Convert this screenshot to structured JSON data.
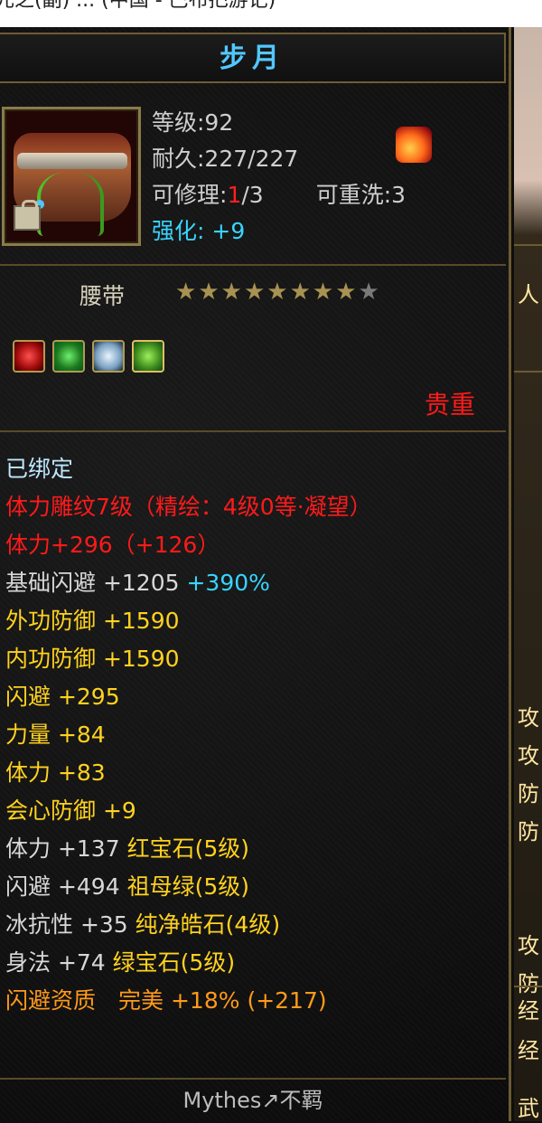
{
  "window": {
    "title_fragment": "元之(副)  ...  (中国 - 巴布把游记)"
  },
  "item": {
    "name": "步月",
    "level_label": "等级:92",
    "durability_label": "耐久:227/227",
    "repair_prefix": "可修理:",
    "repair_current": "1",
    "repair_suffix": "/3",
    "rewash_label": "可重洗:3",
    "enhance_prefix": "强化: ",
    "enhance_value": "+9",
    "type": "腰带",
    "stars_filled": 8,
    "stars_total": 9,
    "quality": "贵重",
    "icon": "belt-icon",
    "flame_icon": "flame-badge-icon",
    "gems": [
      "red-gem-icon",
      "green-gem-icon",
      "white-gem-icon",
      "emerald-gem-icon"
    ]
  },
  "stats": [
    {
      "text": "已绑定",
      "color": "lightblue"
    },
    {
      "text": "体力雕纹7级（精绘：4级0等·凝望）",
      "color": "red"
    },
    {
      "text": "体力+296（+126）",
      "color": "red"
    },
    {
      "text": "基础闪避 +1205",
      "color": "white",
      "extra": "+390%",
      "extra_color": "cyan"
    },
    {
      "text": "外功防御 +1590",
      "color": "yellow"
    },
    {
      "text": "内功防御 +1590",
      "color": "yellow"
    },
    {
      "text": "闪避 +295",
      "color": "yellow"
    },
    {
      "text": "力量 +84",
      "color": "yellow"
    },
    {
      "text": "体力 +83",
      "color": "yellow"
    },
    {
      "text": "会心防御 +9",
      "color": "yellow"
    },
    {
      "text": "体力 +137",
      "color": "white",
      "extra": "红宝石(5级)",
      "extra_color": "yellow"
    },
    {
      "text": "闪避 +494",
      "color": "white",
      "extra": "祖母绿(5级)",
      "extra_color": "yellow"
    },
    {
      "text": "冰抗性 +35",
      "color": "white",
      "extra": "纯净皓石(4级)",
      "extra_color": "yellow"
    },
    {
      "text": "身法 +74",
      "color": "white",
      "extra": "绿宝石(5级)",
      "extra_color": "yellow"
    },
    {
      "text": "闪避资质",
      "color": "orange",
      "extra": "完美 +18% (+217)",
      "extra_color": "orange"
    }
  ],
  "footer": {
    "signature": "Mythes↗不羁"
  },
  "colors": {
    "title": "#52c8ff",
    "red": "#ff1a1a",
    "cyan": "#38d4ff",
    "yellow": "#ffd21e",
    "orange": "#ff9a1a",
    "border": "#6e5c34"
  },
  "side_fragments": [
    "人",
    "攻",
    "攻",
    "防",
    "防",
    "攻",
    "防",
    "经",
    "经",
    "武"
  ]
}
